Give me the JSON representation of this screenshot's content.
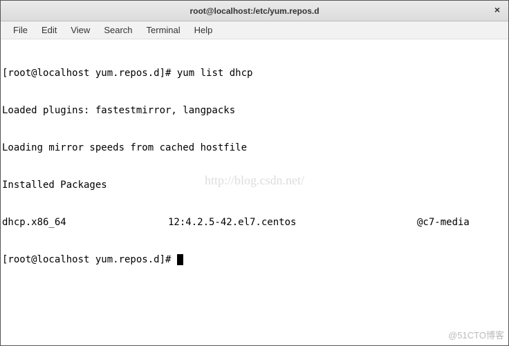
{
  "window": {
    "title": "root@localhost:/etc/yum.repos.d",
    "close": "×"
  },
  "menu": {
    "file": "File",
    "edit": "Edit",
    "view": "View",
    "search": "Search",
    "terminal": "Terminal",
    "help": "Help"
  },
  "terminal": {
    "prompt1": "[root@localhost yum.repos.d]# ",
    "cmd1": "yum list dhcp",
    "out1": "Loaded plugins: fastestmirror, langpacks",
    "out2": "Loading mirror speeds from cached hostfile",
    "out3": "Installed Packages",
    "pkg_name": "dhcp.x86_64",
    "pkg_version": "12:4.2.5-42.el7.centos",
    "pkg_repo": "@c7-media",
    "prompt2": "[root@localhost yum.repos.d]# "
  },
  "watermark": {
    "center": "http://blog.csdn.net/",
    "corner": "@51CTO博客"
  }
}
